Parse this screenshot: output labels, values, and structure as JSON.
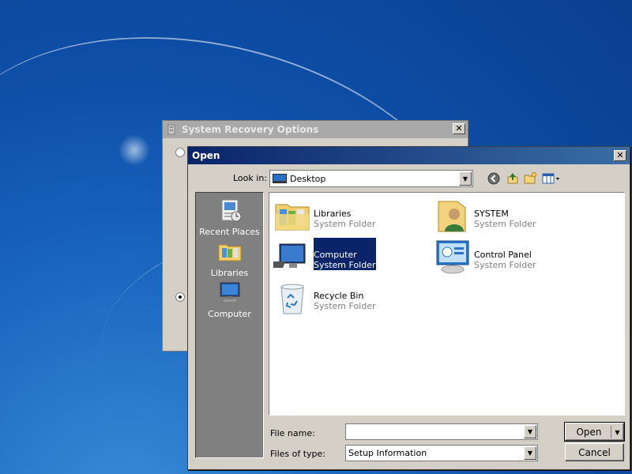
{
  "back_window": {
    "title": "System Recovery Options",
    "close_glyph": "✕"
  },
  "open_dialog": {
    "title": "Open",
    "close_glyph": "✕",
    "look_in_label": "Look in:",
    "look_in_value": "Desktop",
    "toolbar_icons": [
      "back-icon",
      "up-folder-icon",
      "new-folder-icon",
      "view-menu-icon"
    ],
    "places": [
      {
        "label": "Recent Places",
        "icon": "recent-places-icon"
      },
      {
        "label": "Libraries",
        "icon": "libraries-icon"
      },
      {
        "label": "Computer",
        "icon": "computer-icon"
      }
    ],
    "files": [
      {
        "name": "Libraries",
        "type": "System Folder",
        "icon": "libraries-folder-icon"
      },
      {
        "name": "SYSTEM",
        "type": "System Folder",
        "icon": "user-folder-icon"
      },
      {
        "name": "Computer",
        "type": "System Folder",
        "icon": "computer-icon",
        "selected": true
      },
      {
        "name": "Control Panel",
        "type": "System Folder",
        "icon": "control-panel-icon"
      },
      {
        "name": "Recycle Bin",
        "type": "System Folder",
        "icon": "recycle-bin-icon"
      }
    ],
    "file_name_label": "File name:",
    "file_name_value": "",
    "files_of_type_label": "Files of type:",
    "files_of_type_value": "Setup Information",
    "open_button": "Open",
    "cancel_button": "Cancel"
  },
  "colors": {
    "title_active": "#0a246a",
    "title_inactive": "#a9a9a9",
    "selection": "#0a246a",
    "dialog_face": "#d4d0c8"
  }
}
